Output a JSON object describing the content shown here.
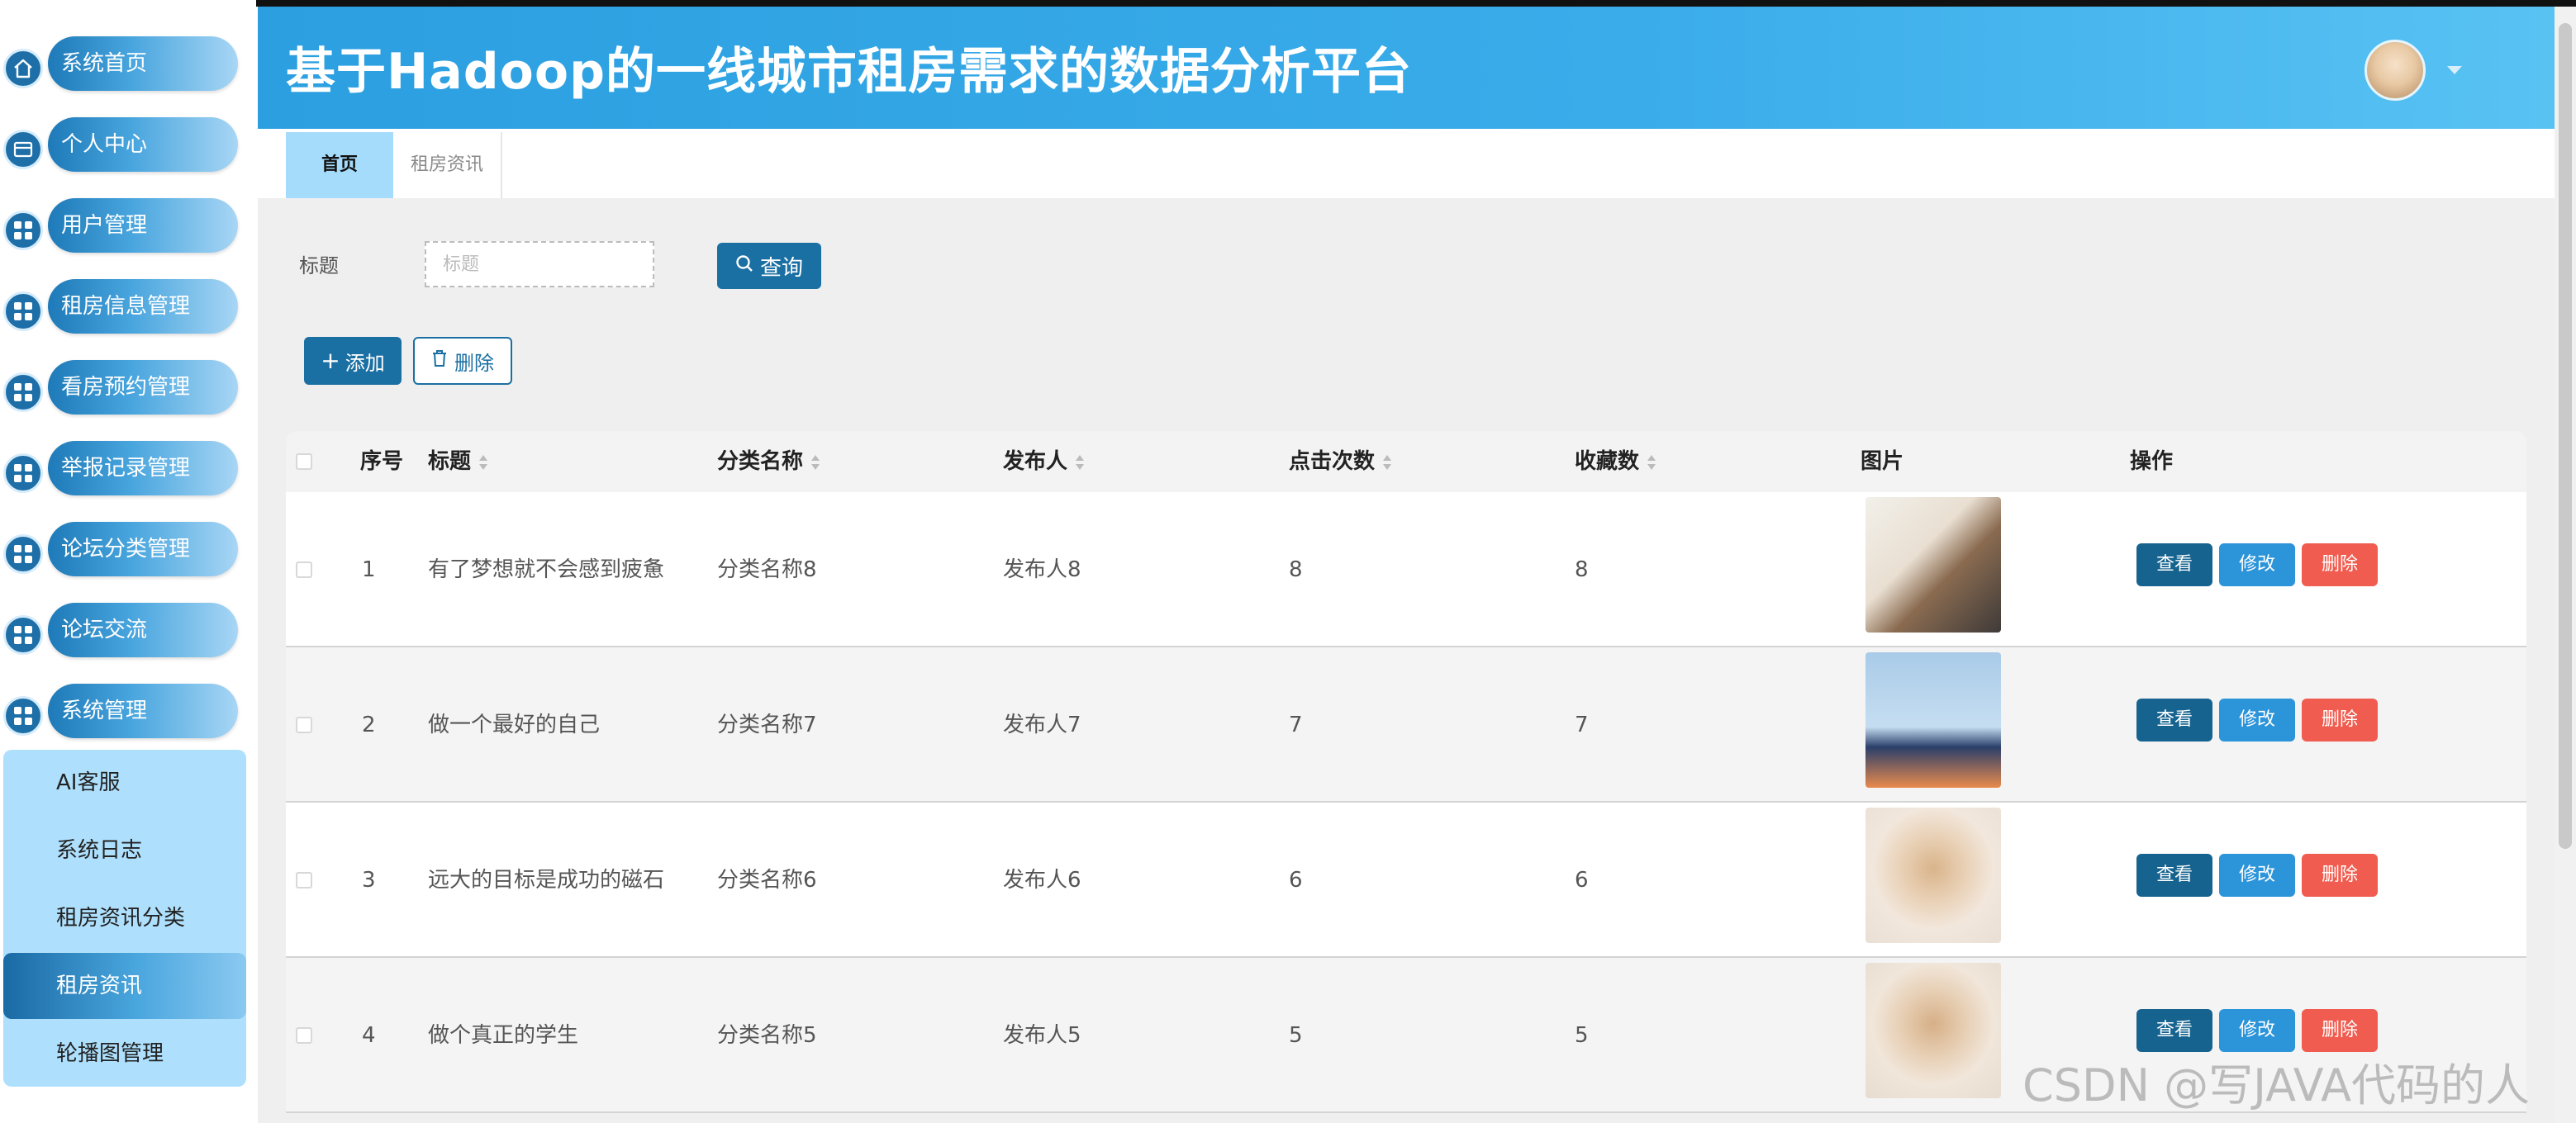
{
  "app": {
    "title": "基于Hadoop的一线城市租房需求的数据分析平台"
  },
  "sidebar": {
    "items": [
      {
        "label": "系统首页",
        "icon": "home-icon"
      },
      {
        "label": "个人中心",
        "icon": "profile-card-icon"
      },
      {
        "label": "用户管理",
        "icon": "grid-icon"
      },
      {
        "label": "租房信息管理",
        "icon": "grid-icon"
      },
      {
        "label": "看房预约管理",
        "icon": "grid-icon"
      },
      {
        "label": "举报记录管理",
        "icon": "grid-icon"
      },
      {
        "label": "论坛分类管理",
        "icon": "grid-icon"
      },
      {
        "label": "论坛交流",
        "icon": "grid-icon"
      },
      {
        "label": "系统管理",
        "icon": "grid-icon"
      }
    ],
    "submenu": [
      "AI客服",
      "系统日志",
      "租房资讯分类",
      "租房资讯",
      "轮播图管理"
    ],
    "submenu_active": "租房资讯"
  },
  "tabs": [
    {
      "label": "首页",
      "active": true
    },
    {
      "label": "租房资讯",
      "active": false
    }
  ],
  "search": {
    "label": "标题",
    "placeholder": "标题",
    "button": "查询"
  },
  "actions": {
    "add": "添加",
    "delete": "删除"
  },
  "table": {
    "columns": [
      "序号",
      "标题",
      "分类名称",
      "发布人",
      "点击次数",
      "收藏数",
      "图片",
      "操作"
    ],
    "rows": [
      {
        "no": "1",
        "title": "有了梦想就不会感到疲惫",
        "category": "分类名称8",
        "publisher": "发布人8",
        "clicks": "8",
        "favorites": "8"
      },
      {
        "no": "2",
        "title": "做一个最好的自己",
        "category": "分类名称7",
        "publisher": "发布人7",
        "clicks": "7",
        "favorites": "7"
      },
      {
        "no": "3",
        "title": "远大的目标是成功的磁石",
        "category": "分类名称6",
        "publisher": "发布人6",
        "clicks": "6",
        "favorites": "6"
      },
      {
        "no": "4",
        "title": "做个真正的学生",
        "category": "分类名称5",
        "publisher": "发布人5",
        "clicks": "5",
        "favorites": "5"
      }
    ],
    "row_actions": {
      "view": "查看",
      "edit": "修改",
      "delete": "删除"
    }
  },
  "watermark": "CSDN @写JAVA代码的人",
  "colors": {
    "header": "#3aacea",
    "primary": "#1a6fa3",
    "edit": "#2c94d9",
    "danger": "#f05c4f",
    "submenu_bg": "#aee0fd"
  }
}
